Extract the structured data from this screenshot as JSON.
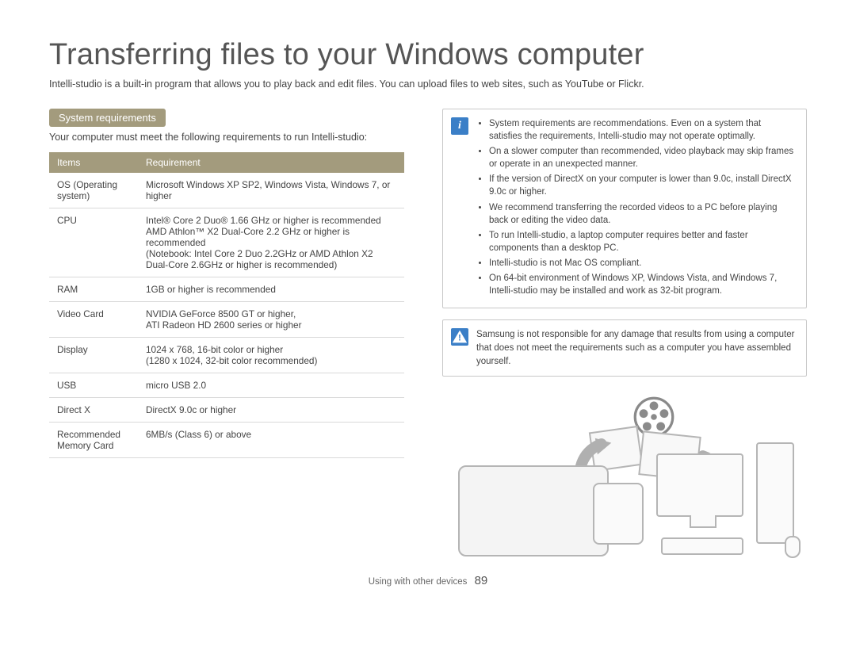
{
  "title": "Transferring files to your Windows computer",
  "intro": "Intelli-studio is a built-in program that allows you to play back and edit files. You can upload files to web sites, such as YouTube or Flickr.",
  "section_badge": "System requirements",
  "section_sub": "Your computer must meet the following requirements to run Intelli-studio:",
  "table": {
    "head": {
      "c1": "Items",
      "c2": "Requirement"
    },
    "rows": [
      {
        "c1": "OS (Operating system)",
        "c2": "Microsoft Windows XP SP2, Windows Vista, Windows 7, or higher"
      },
      {
        "c1": "CPU",
        "c2": "Intel® Core 2 Duo® 1.66 GHz or higher is recommended\nAMD Athlon™ X2 Dual-Core 2.2 GHz or higher is recommended\n(Notebook: Intel Core 2 Duo 2.2GHz or AMD Athlon X2 Dual-Core 2.6GHz or higher is recommended)"
      },
      {
        "c1": "RAM",
        "c2": "1GB or higher is recommended"
      },
      {
        "c1": "Video Card",
        "c2": "NVIDIA GeForce 8500 GT or higher,\nATI Radeon HD 2600 series or higher"
      },
      {
        "c1": "Display",
        "c2": "1024 x 768, 16-bit color or higher\n(1280 x 1024, 32-bit color recommended)"
      },
      {
        "c1": "USB",
        "c2": "micro USB 2.0"
      },
      {
        "c1": "Direct X",
        "c2": "DirectX 9.0c or higher"
      },
      {
        "c1": "Recommended Memory Card",
        "c2": "6MB/s (Class 6) or above"
      }
    ]
  },
  "notes": [
    "System requirements are recommendations. Even on a system that satisfies the requirements, Intelli-studio may not operate optimally.",
    "On a slower computer than recommended, video playback may skip frames or operate in an unexpected manner.",
    "If the version of DirectX on your computer is lower than 9.0c, install DirectX 9.0c or higher.",
    "We recommend transferring the recorded videos to a PC before playing back or editing the video data.",
    "To run Intelli-studio, a laptop computer requires better and faster components than a desktop PC.",
    "Intelli-studio is not Mac OS compliant.",
    "On 64-bit environment of Windows XP, Windows Vista, and Windows 7, Intelli-studio may be installed and work as 32-bit program."
  ],
  "warning": "Samsung is not responsible for any damage that results from using a computer that does not meet the requirements such as a computer you have assembled yourself.",
  "footer_label": "Using with other devices",
  "page_number": "89"
}
